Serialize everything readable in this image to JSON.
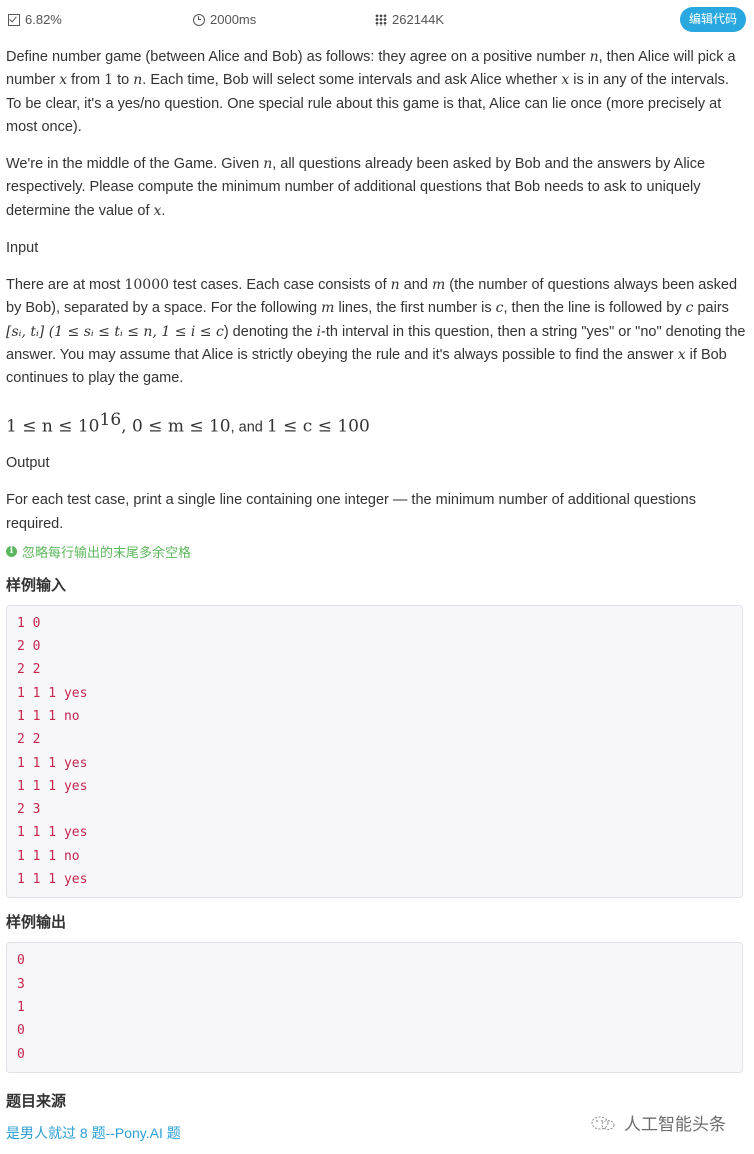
{
  "stats": {
    "acceptance": "6.82%",
    "time_limit": "2000ms",
    "memory_limit": "262144K",
    "edit_button": "编辑代码"
  },
  "description": {
    "p1": {
      "t1": "Define number game (between Alice and Bob) as follows: they agree on a positive number ",
      "m1": "n",
      "t2": ", then Alice will pick a number ",
      "m2": "x",
      "t3": " from ",
      "m3": "1",
      "t4": " to ",
      "m4": "n",
      "t5": ". Each time, Bob will select some intervals and ask Alice whether ",
      "m5": "x",
      "t6": " is in any of the intervals. To be clear, it's a yes/no question. One special rule about this game is that, Alice can lie once (more precisely at most once)."
    },
    "p2": {
      "t1": "We're in the middle of the Game. Given ",
      "m1": "n",
      "t2": ", all questions already been asked by Bob and the answers by Alice respectively. Please compute the minimum number of additional questions that Bob needs to ask to uniquely determine the value of ",
      "m2": "x",
      "t3": "."
    }
  },
  "input_section": {
    "heading": "Input",
    "t1": "There are at most ",
    "m1": "10000",
    "t2": " test cases. Each case consists of ",
    "m2": "n",
    "t3": " and ",
    "m3": "m",
    "t4": " (the number of questions always been asked by Bob), separated by a space. For the following ",
    "m4": "m",
    "t5": " lines, the first number is ",
    "m5": "c",
    "t6": ", then the line is followed by ",
    "m6": "c",
    "t7": " pairs ",
    "m7": "[sᵢ, tᵢ] (1 ≤ sᵢ ≤ tᵢ ≤ n, 1 ≤ i ≤ c",
    "t8": ") denoting the ",
    "m8": "i",
    "t9": "-th interval in this question, then a string \"yes\" or \"no\" denoting the answer. You may assume that Alice is strictly obeying the rule and it's always possible to find the answer ",
    "m9": "x",
    "t10": " if Bob continues to play the game."
  },
  "constraints": {
    "c1": "1 ≤ n ≤ 10",
    "c1_exp": "16",
    "c2": ", 0 ≤ m ≤ 10",
    "and": ", and ",
    "c3": "1 ≤ c ≤ 100"
  },
  "output_section": {
    "heading": "Output",
    "text": "For each test case, print a single line containing one integer — the minimum number of additional questions required."
  },
  "note": {
    "icon": "info-icon",
    "text": "忽略每行输出的末尾多余空格"
  },
  "sample_input": {
    "title": "样例输入",
    "lines": [
      "1 0",
      "2 0",
      "2 2",
      "1 1 1 yes",
      "1 1 1 no",
      "2 2",
      "1 1 1 yes",
      "1 1 1 yes",
      "2 3",
      "1 1 1 yes",
      "1 1 1 no",
      "1 1 1 yes"
    ]
  },
  "sample_output": {
    "title": "样例输出",
    "lines": [
      "0",
      "3",
      "1",
      "0",
      "0"
    ]
  },
  "source": {
    "title": "题目来源",
    "link": "是男人就过 8 题--Pony.AI 题"
  },
  "watermark": {
    "text": "人工智能头条"
  },
  "colors": {
    "accent": "#29a8e0",
    "link": "#2a9fd6",
    "note_green": "#5cb85c",
    "code_red": "#c7254e"
  }
}
